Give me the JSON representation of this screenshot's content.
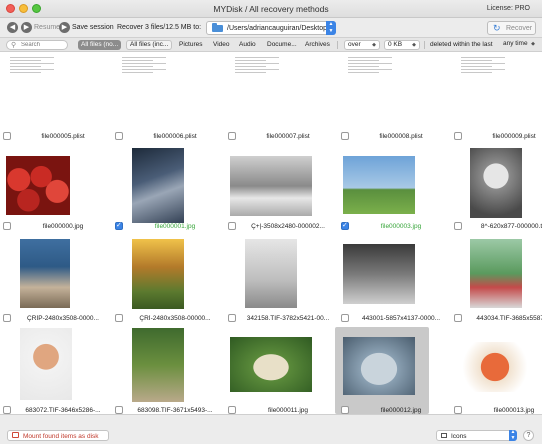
{
  "window": {
    "title": "MYDisk / All recovery methods",
    "license": "License: PRO"
  },
  "toolbar": {
    "back_icon": "circle-left-arrow-icon",
    "resume_label": "Resume",
    "save_session_label": "Save session",
    "recover_info": "Recover 3 files/12.5 MB to:",
    "destination_path": "/Users/adriancauguiran/Desktop",
    "recover_label": "Recover"
  },
  "filters": {
    "search_placeholder": "Search",
    "tabs": [
      "All files (no...",
      "All files (inc...",
      "Pictures",
      "Video",
      "Audio",
      "Docume...",
      "Archives"
    ],
    "selected_tab": "All files (no...",
    "size_operator": "over",
    "size_value": "0 KB",
    "deleted_label": "deleted within the last",
    "time_range": "any time"
  },
  "files": [
    {
      "name": "file000005.plist",
      "checked": false,
      "thumb": "plist"
    },
    {
      "name": "file000006.plist",
      "checked": false,
      "thumb": "plist"
    },
    {
      "name": "file000007.plist",
      "checked": false,
      "thumb": "plist"
    },
    {
      "name": "file000008.plist",
      "checked": false,
      "thumb": "plist"
    },
    {
      "name": "file000009.plist",
      "checked": false,
      "thumb": "plist"
    },
    {
      "name": "file000000.jpg",
      "checked": false,
      "thumb": "ph-straw"
    },
    {
      "name": "file000001.jpg",
      "checked": true,
      "thumb": "ph-road"
    },
    {
      "name": "Ç+|-3508x2480-000002...",
      "checked": false,
      "thumb": "ph-bath"
    },
    {
      "name": "file000003.jpg",
      "checked": true,
      "thumb": "ph-beach"
    },
    {
      "name": "8^-620x877-000000.tiff",
      "checked": false,
      "thumb": "ph-girl"
    },
    {
      "name": "ÇRÌP-2480x3508-0000...",
      "checked": false,
      "thumb": "ph-kids"
    },
    {
      "name": "ÇRÌ-2480x3508-00000...",
      "checked": false,
      "thumb": "ph-swing"
    },
    {
      "name": "342158.TIF-3782x5421-00...",
      "checked": false,
      "thumb": "ph-runner"
    },
    {
      "name": "443001-5857x4137-0000...",
      "checked": false,
      "thumb": "ph-jump"
    },
    {
      "name": "443034.TIF-3685x5587-...",
      "checked": false,
      "thumb": "ph-fountain"
    },
    {
      "name": "683072.TIF-3646x5286-...",
      "checked": false,
      "thumb": "ph-man"
    },
    {
      "name": "683098.TIF-3671x5493-...",
      "checked": false,
      "thumb": "ph-family"
    },
    {
      "name": "file000011.jpg",
      "checked": false,
      "thumb": "ph-fish"
    },
    {
      "name": "file000012.jpg",
      "checked": false,
      "thumb": "ph-seafood"
    },
    {
      "name": "file000013.jpg",
      "checked": false,
      "thumb": "ph-bowl"
    }
  ],
  "statusbar": {
    "mount_label": "Mount found items as disk",
    "view_mode": "Icons",
    "help_label": "?"
  },
  "colors": {
    "accent": "#3b84e6",
    "selected_name": "#37a53a",
    "mount_text": "#c0392b"
  }
}
